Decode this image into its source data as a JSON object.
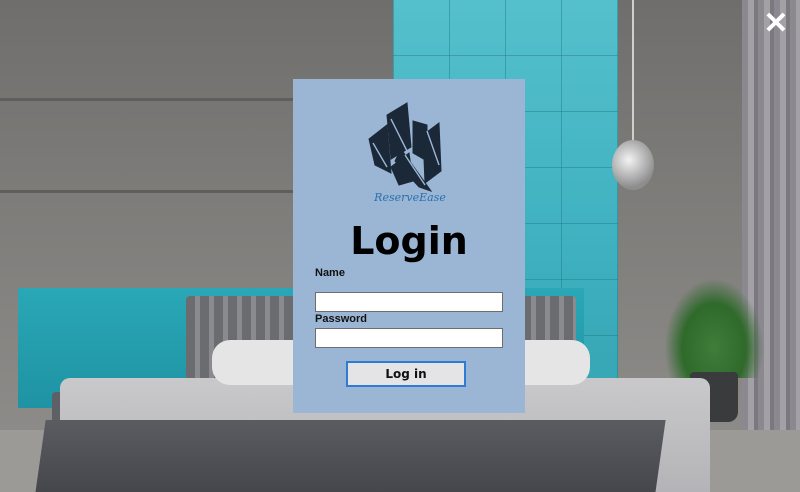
{
  "close": {
    "icon": "close-icon",
    "glyph": "✕"
  },
  "card": {
    "logo_icon": "city-buildings-logo",
    "logo_text": "ReserveEase",
    "title": "Login",
    "name_label": "Name",
    "name_value": "",
    "password_label": "Password",
    "password_value": "",
    "login_button": "Log in"
  },
  "colors": {
    "card_bg": "#9bb6d5",
    "button_border": "#2f7bd1",
    "logo_dark": "#1b2838"
  }
}
